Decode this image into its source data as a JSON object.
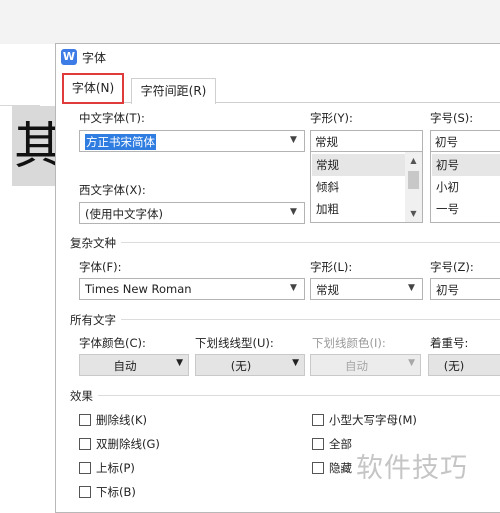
{
  "document": {
    "preview_char": "其"
  },
  "dialog": {
    "title": "字体",
    "app_icon": "W",
    "tabs": [
      {
        "label": "字体(N)",
        "active": true
      },
      {
        "label": "字符间距(R)",
        "active": false
      }
    ]
  },
  "font": {
    "chinese_label": "中文字体(T):",
    "chinese_value": "方正书宋简体",
    "western_label": "西文字体(X):",
    "western_value": "(使用中文字体)",
    "style_label": "字形(Y):",
    "style_value": "常规",
    "style_options": [
      "常规",
      "倾斜",
      "加粗"
    ],
    "size_label": "字号(S):",
    "size_value": "初号",
    "size_options": [
      "初号",
      "小初",
      "一号"
    ]
  },
  "complex": {
    "section": "复杂文种",
    "font_label": "字体(F):",
    "font_value": "Times New Roman",
    "style_label": "字形(L):",
    "style_value": "常规",
    "size_label": "字号(Z):",
    "size_value": "初号"
  },
  "all_text": {
    "section": "所有文字",
    "color_label": "字体颜色(C):",
    "color_value": "自动",
    "underline_label": "下划线线型(U):",
    "underline_value": "(无)",
    "underline_color_label": "下划线颜色(I):",
    "underline_color_value": "自动",
    "emphasis_label": "着重号:",
    "emphasis_value": "(无)"
  },
  "effects": {
    "section": "效果",
    "strike": "删除线(K)",
    "double_strike": "双删除线(G)",
    "superscript": "上标(P)",
    "subscript": "下标(B)",
    "small_caps": "小型大写字母(M)",
    "all_caps": "全部",
    "hidden": "隐藏"
  },
  "watermark": "软件技巧",
  "icons": {
    "dropdown": "chevron-down-icon",
    "scroll_up": "scroll-up-icon",
    "scroll_down": "scroll-down-icon"
  },
  "colors": {
    "selection": "#2f7de1",
    "tab_highlight": "#e03b3b",
    "app_icon": "#3d7be6"
  }
}
